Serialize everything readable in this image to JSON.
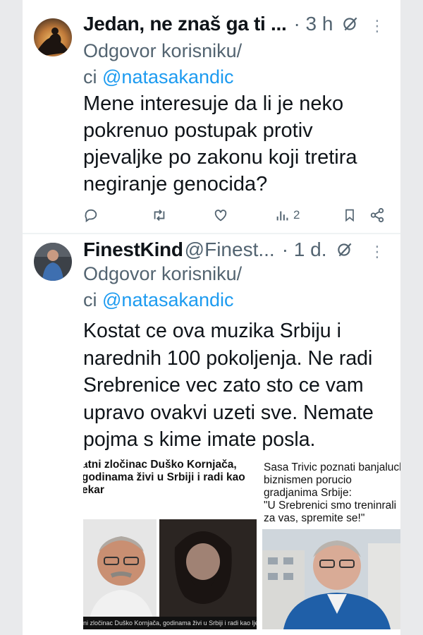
{
  "tweets": [
    {
      "display_name": "Jedan, ne znaš ga ti ...",
      "handle": "",
      "time": "· 3 h",
      "reply_prefix": "Odgovor korisniku/",
      "reply_prefix2": "ci",
      "mention": "@natasakandic",
      "text": "Mene interesuje da li je neko pokrenuo postupak protiv pjevaljke po zakonu koji tretira negiranje genocida?",
      "actions": {
        "replies": "",
        "retweets": "",
        "likes": "",
        "views": "2"
      }
    },
    {
      "display_name": "FinestKind",
      "handle": "@Finest...",
      "time": "· 1 d.",
      "reply_prefix": "Odgovor korisniku/",
      "reply_prefix2": "ci",
      "mention": "@natasakandic",
      "text": "Kostat ce ova muzika Srbiju i narednih 100 pokoljenja. Ne radi Srebrenice vec zato sto ce vam upravo ovakvi uzeti sve. Nemate pojma s kime imate posla."
    }
  ],
  "media": {
    "left_headline": "atni zločinac Duško Kornjača, godinama živi u Srbiji i radi kao ekar",
    "left_caption": "ni zločinac Duško Kornjača, godinama živi u Srbiji i radi kao ljekar",
    "right_headline": "Sasa Trivic poznati banjalucki biznismen porucio gradjanima Srbije:",
    "right_quote": "\"U Srebrenici smo treninrali za vas, spremite se!\""
  },
  "icons": [
    "reply-icon",
    "retweet-icon",
    "like-icon",
    "views-icon",
    "bookmark-icon",
    "share-icon",
    "grok-icon",
    "more-icon"
  ],
  "colors": {
    "accent": "#1d9bf0",
    "muted": "#536471"
  }
}
